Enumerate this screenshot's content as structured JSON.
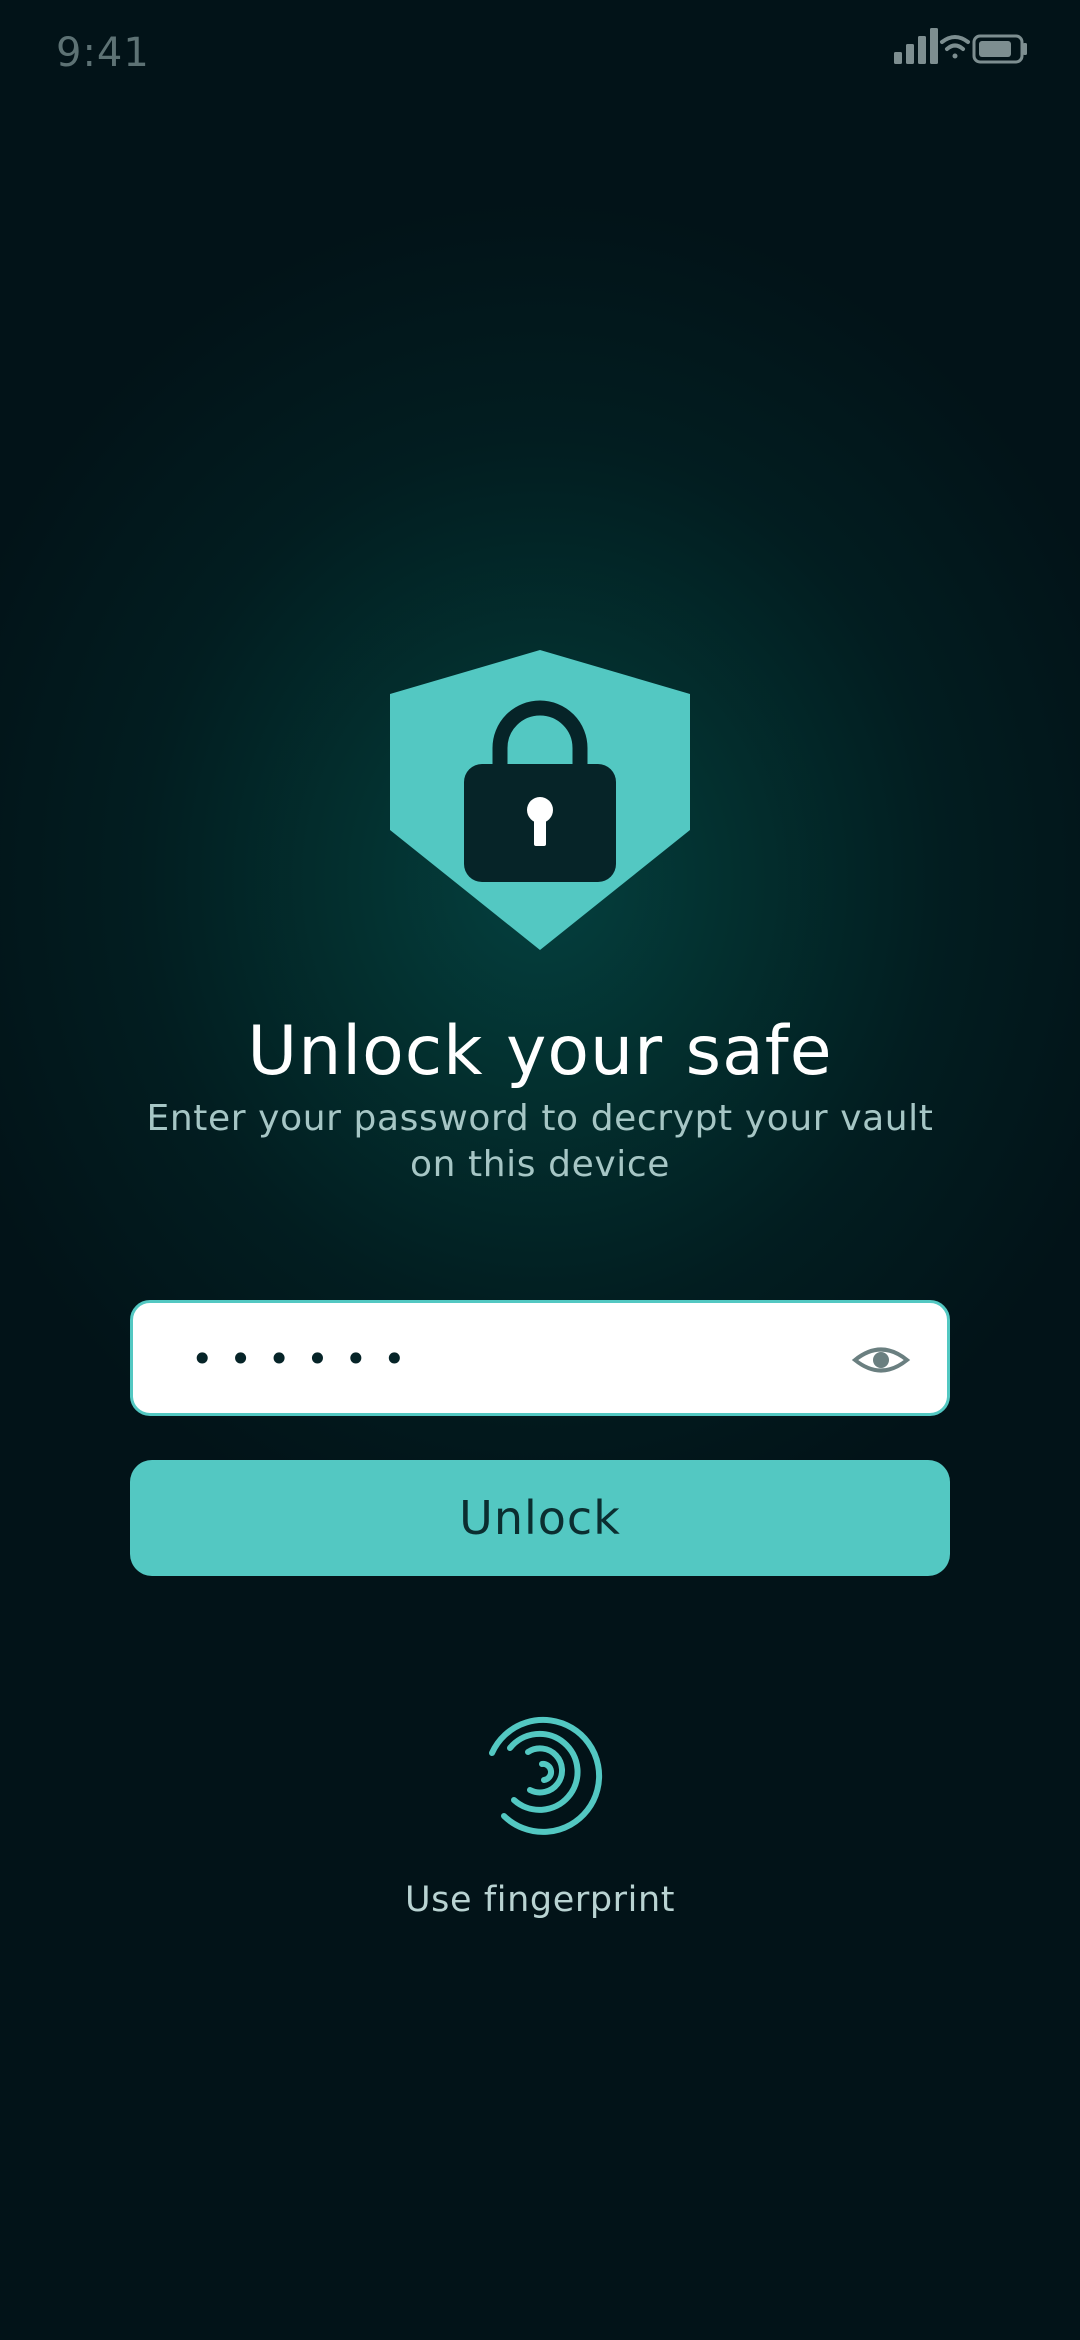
{
  "status_bar": {
    "time": "9:41",
    "icons": [
      "signal-icon",
      "wifi-icon",
      "battery-icon"
    ]
  },
  "hero": {
    "icon": "shield-lock-icon",
    "title": "Unlock your safe",
    "subtitle": "Enter your password to decrypt your vault on this device"
  },
  "password_field": {
    "value_masked": "••••••",
    "toggle_icon": "eye-icon"
  },
  "unlock_button": {
    "label": "Unlock"
  },
  "fingerprint": {
    "icon": "fingerprint-icon",
    "label": "Use fingerprint"
  },
  "colors": {
    "accent": "#53c8c2",
    "background": "#021d20",
    "text_primary": "#ffffff",
    "text_secondary": "#a6c6c5"
  }
}
